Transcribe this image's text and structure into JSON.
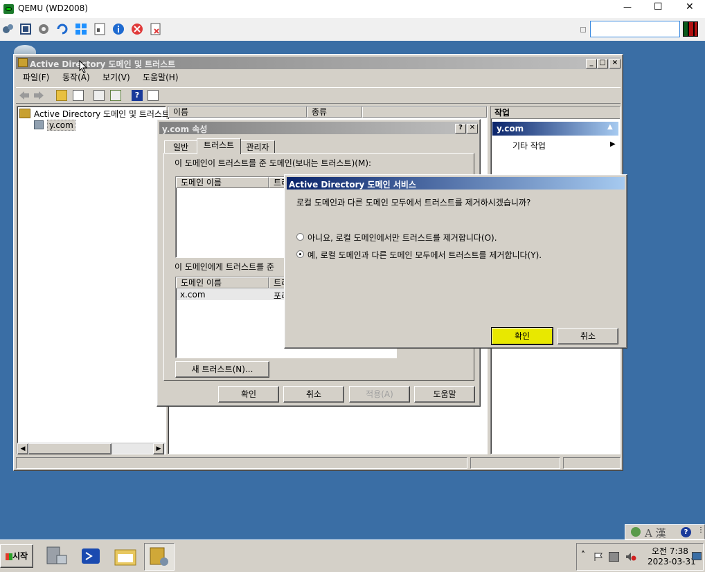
{
  "qemu": {
    "title": "QEMU (WD2008)",
    "win_controls": {
      "minimize": "—",
      "maximize": "☐",
      "close": "✕"
    },
    "toolbar_icons": [
      "settings-gears-icon",
      "fullscreen-icon",
      "gear-icon",
      "refresh-icon",
      "windows-icon",
      "document-icon",
      "info-icon",
      "stop-icon",
      "dismiss-icon"
    ],
    "search_value": ""
  },
  "ad_window": {
    "title": "Active Directory 도메인 및 트러스트",
    "menu": [
      "파일(F)",
      "동작(A)",
      "보기(V)",
      "도움말(H)"
    ],
    "tree_root": "Active Directory 도메인 및 트러스트",
    "tree_child": "y.com",
    "list_columns": [
      "이름",
      "종류"
    ],
    "actions_header": "작업",
    "actions_section": "y.com",
    "actions_item": "기타 작업"
  },
  "props_dialog": {
    "title": "y.com 속성",
    "help_btn": "?",
    "close_btn": "✕",
    "tabs": [
      "일반",
      "트러스트",
      "관리자"
    ],
    "outgoing_label": "이 도메인이 트러스트를 준 도메인(보내는 트러스트)(M):",
    "outgoing_columns": [
      "도메인 이름",
      "트리"
    ],
    "incoming_label": "이 도메인에게 트러스트를 준",
    "incoming_columns": [
      "도메인 이름",
      "트리"
    ],
    "incoming_rows": [
      {
        "name": "x.com",
        "type": "포리"
      }
    ],
    "new_trust_btn": "새 트러스트(N)...",
    "ok_btn": "확인",
    "cancel_btn": "취소",
    "apply_btn": "적용(A)",
    "help_btn_bottom": "도움말"
  },
  "ads_dialog": {
    "title": "Active Directory 도메인 서비스",
    "question": "로컬 도메인과 다른 도메인 모두에서 트러스트를 제거하시겠습니까?",
    "option_no": "아니요, 로컬 도메인에서만 트러스트를 제거합니다(O).",
    "option_yes": "예, 로컬 도메인과 다른 도메인 모두에서 트러스트를 제거합니다(Y).",
    "selected": "yes",
    "ok_btn": "확인",
    "cancel_btn": "취소"
  },
  "taskbar": {
    "start": "시작",
    "language_bar": "A 漢",
    "clock_time": "오전 7:38",
    "clock_date": "2023-03-31",
    "tray_chevron": "˄"
  },
  "colors": {
    "desktop": "#3a6ea5",
    "caption_active": "#0a246a",
    "highlight_ok": "#e8e800"
  }
}
